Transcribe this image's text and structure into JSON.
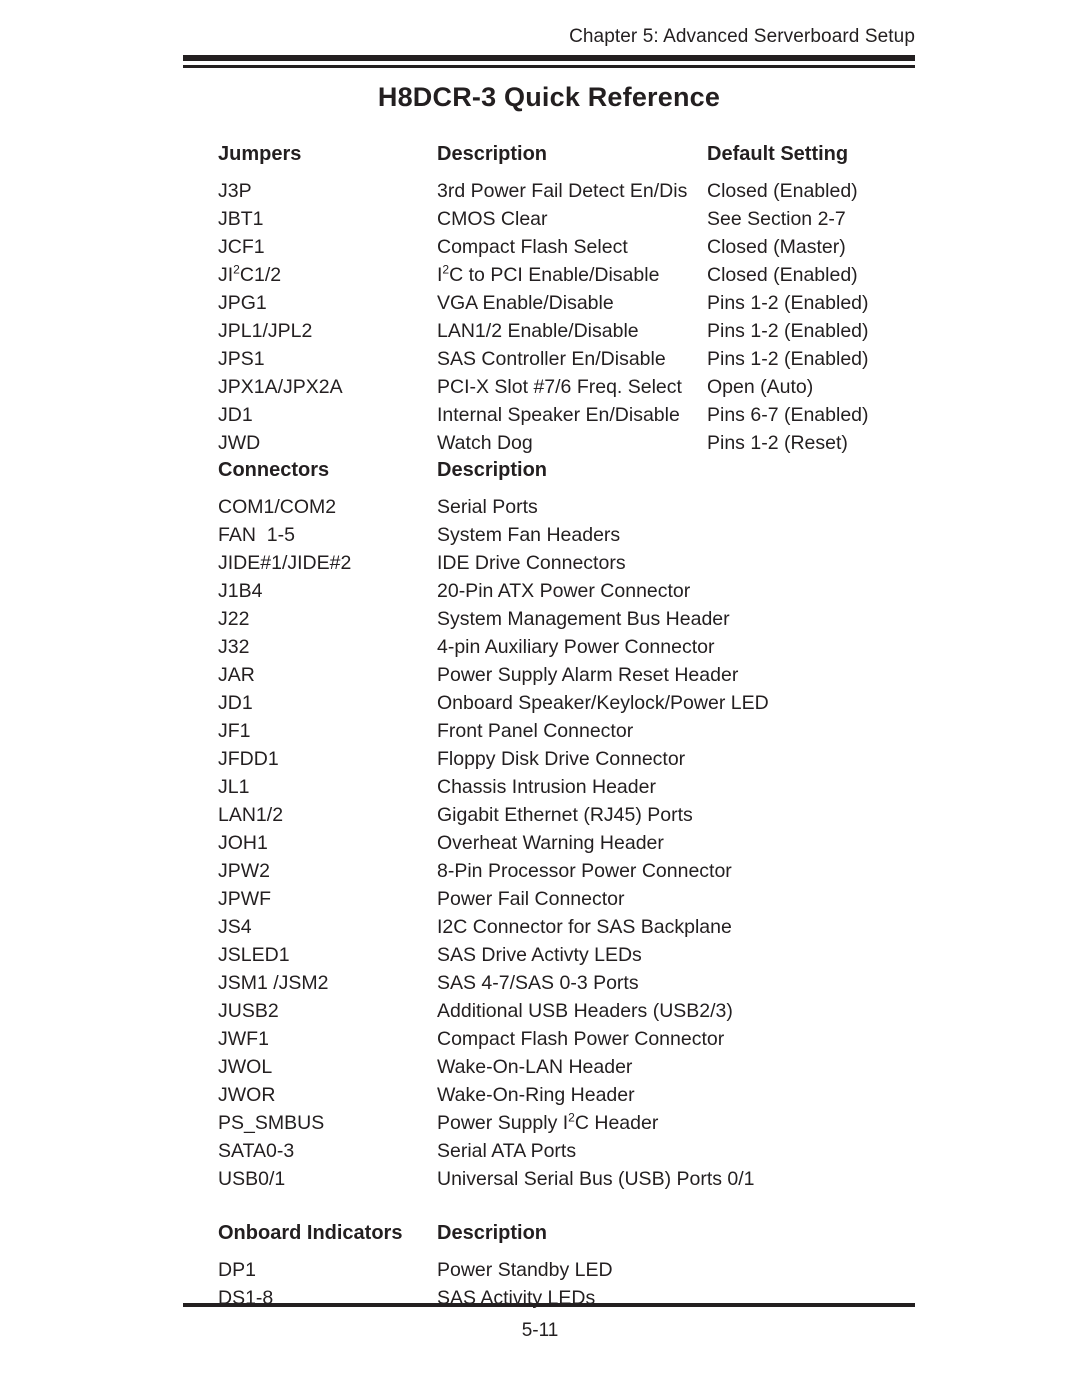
{
  "header": {
    "running_head": "Chapter 5: Advanced Serverboard Setup",
    "title": "H8DCR-3 Quick Reference"
  },
  "jumpers": {
    "columns": [
      "Jumpers",
      "Description",
      "Default Setting"
    ],
    "rows": [
      {
        "key": "J3P",
        "key_html": "J3P",
        "description": "3rd Power Fail Detect En/Dis",
        "description_html": "3rd Power Fail Detect En/Dis",
        "setting": "Closed (Enabled)"
      },
      {
        "key": "JBT1",
        "key_html": "JBT1",
        "description": "CMOS Clear",
        "description_html": "CMOS Clear",
        "setting": "See Section 2-7"
      },
      {
        "key": "JCF1",
        "key_html": "JCF1",
        "description": "Compact Flash Select",
        "description_html": "Compact Flash Select",
        "setting": "Closed (Master)"
      },
      {
        "key": "JI2C1/2",
        "key_html": "JI<sup>2</sup>C1/2",
        "description": "I2C to PCI Enable/Disable",
        "description_html": "I<sup>2</sup>C to PCI Enable/Disable",
        "setting": "Closed (Enabled)"
      },
      {
        "key": "JPG1",
        "key_html": "JPG1",
        "description": "VGA Enable/Disable",
        "description_html": "VGA Enable/Disable",
        "setting": "Pins 1-2 (Enabled)"
      },
      {
        "key": "JPL1/JPL2",
        "key_html": "JPL1/JPL2",
        "description": "LAN1/2 Enable/Disable",
        "description_html": "LAN1/2 Enable/Disable",
        "setting": "Pins 1-2 (Enabled)"
      },
      {
        "key": "JPS1",
        "key_html": "JPS1",
        "description": "SAS Controller En/Disable",
        "description_html": "SAS Controller En/Disable",
        "setting": "Pins 1-2 (Enabled)"
      },
      {
        "key": "JPX1A/JPX2A",
        "key_html": "JPX1A/JPX2A",
        "description": "PCI-X Slot #7/6 Freq. Select",
        "description_html": "PCI-X Slot #7/6 Freq. Select",
        "setting": "Open (Auto)"
      },
      {
        "key": "JD1",
        "key_html": "JD1",
        "description": "Internal Speaker En/Disable",
        "description_html": "Internal Speaker En/Disable",
        "setting": "Pins 6-7 (Enabled)"
      },
      {
        "key": "JWD",
        "key_html": "JWD",
        "description": "Watch Dog",
        "description_html": "Watch Dog",
        "setting": "Pins 1-2 (Reset)"
      }
    ]
  },
  "connectors": {
    "columns": [
      "Connectors",
      "Description"
    ],
    "rows": [
      {
        "key": "COM1/COM2",
        "key_html": "COM1/COM2",
        "description": "Serial Ports",
        "description_html": "Serial Ports"
      },
      {
        "key": "FAN 1-5",
        "key_html": "FAN&nbsp;&nbsp;1-5",
        "description": "System Fan Headers",
        "description_html": "System Fan Headers"
      },
      {
        "key": "JIDE#1/JIDE#2",
        "key_html": "JIDE#1/JIDE#2",
        "description": "IDE Drive Connectors",
        "description_html": "IDE Drive Connectors"
      },
      {
        "key": "J1B4",
        "key_html": "J1B4",
        "description": "20-Pin ATX Power Connector",
        "description_html": "20-Pin ATX Power Connector"
      },
      {
        "key": "J22",
        "key_html": "J22",
        "description": "System Management Bus Header",
        "description_html": "System Management Bus Header"
      },
      {
        "key": "J32",
        "key_html": "J32",
        "description": "4-pin Auxiliary Power Connector",
        "description_html": "4-pin Auxiliary Power Connector"
      },
      {
        "key": "JAR",
        "key_html": "JAR",
        "description": "Power Supply Alarm Reset Header",
        "description_html": "Power Supply Alarm Reset Header"
      },
      {
        "key": "JD1",
        "key_html": "JD1",
        "description": "Onboard Speaker/Keylock/Power LED",
        "description_html": "Onboard Speaker/Keylock/Power LED"
      },
      {
        "key": "JF1",
        "key_html": "JF1",
        "description": "Front Panel Connector",
        "description_html": "Front Panel Connector"
      },
      {
        "key": "JFDD1",
        "key_html": "JFDD1",
        "description": "Floppy Disk Drive Connector",
        "description_html": "Floppy Disk Drive Connector"
      },
      {
        "key": "JL1",
        "key_html": "JL1",
        "description": "Chassis Intrusion Header",
        "description_html": "Chassis Intrusion Header"
      },
      {
        "key": "LAN1/2",
        "key_html": "LAN1/2",
        "description": "Gigabit Ethernet (RJ45) Ports",
        "description_html": "Gigabit Ethernet (RJ45) Ports"
      },
      {
        "key": "JOH1",
        "key_html": "JOH1",
        "description": "Overheat Warning Header",
        "description_html": "Overheat Warning Header"
      },
      {
        "key": "JPW2",
        "key_html": "JPW2",
        "description": "8-Pin Processor Power Connector",
        "description_html": "8-Pin Processor Power Connector"
      },
      {
        "key": "JPWF",
        "key_html": "JPWF",
        "description": "Power Fail Connector",
        "description_html": "Power Fail Connector"
      },
      {
        "key": "JS4",
        "key_html": "JS4",
        "description": "I2C Connector for SAS Backplane",
        "description_html": "I2C Connector for SAS Backplane"
      },
      {
        "key": "JSLED1",
        "key_html": "JSLED1",
        "description": "SAS Drive Activty LEDs",
        "description_html": "SAS Drive Activty LEDs"
      },
      {
        "key": "JSM1 /JSM2",
        "key_html": "JSM1&nbsp;/JSM2",
        "description": "SAS 4-7/SAS 0-3 Ports",
        "description_html": "SAS 4-7/SAS 0-3 Ports"
      },
      {
        "key": "JUSB2",
        "key_html": "JUSB2",
        "description": "Additional USB Headers (USB2/3)",
        "description_html": "Additional USB Headers (USB2/3)"
      },
      {
        "key": "JWF1",
        "key_html": "JWF1",
        "description": "Compact Flash Power Connector",
        "description_html": "Compact Flash Power Connector"
      },
      {
        "key": "JWOL",
        "key_html": "JWOL",
        "description": "Wake-On-LAN Header",
        "description_html": "Wake-On-LAN Header"
      },
      {
        "key": "JWOR",
        "key_html": "JWOR",
        "description": "Wake-On-Ring Header",
        "description_html": "Wake-On-Ring Header"
      },
      {
        "key": "PS_SMBUS",
        "key_html": "PS_SMBUS",
        "description": "Power Supply I2C Header",
        "description_html": "Power Supply I<sup>2</sup>C Header"
      },
      {
        "key": "SATA0-3",
        "key_html": "SATA0-3",
        "description": "Serial ATA Ports",
        "description_html": "Serial ATA Ports"
      },
      {
        "key": "USB0/1",
        "key_html": "USB0/1",
        "description": "Universal Serial Bus (USB) Ports 0/1",
        "description_html": "Universal Serial Bus (USB) Ports 0/1"
      }
    ]
  },
  "indicators": {
    "columns": [
      "Onboard Indicators",
      "Description"
    ],
    "rows": [
      {
        "key": "DP1",
        "key_html": "DP1",
        "description": "Power Standby LED",
        "description_html": "Power Standby LED"
      },
      {
        "key": "DS1-8",
        "key_html": "DS1-8",
        "description": "SAS Activity LEDs",
        "description_html": "SAS Activity LEDs"
      }
    ]
  },
  "footer": {
    "page_number": "5-11"
  }
}
